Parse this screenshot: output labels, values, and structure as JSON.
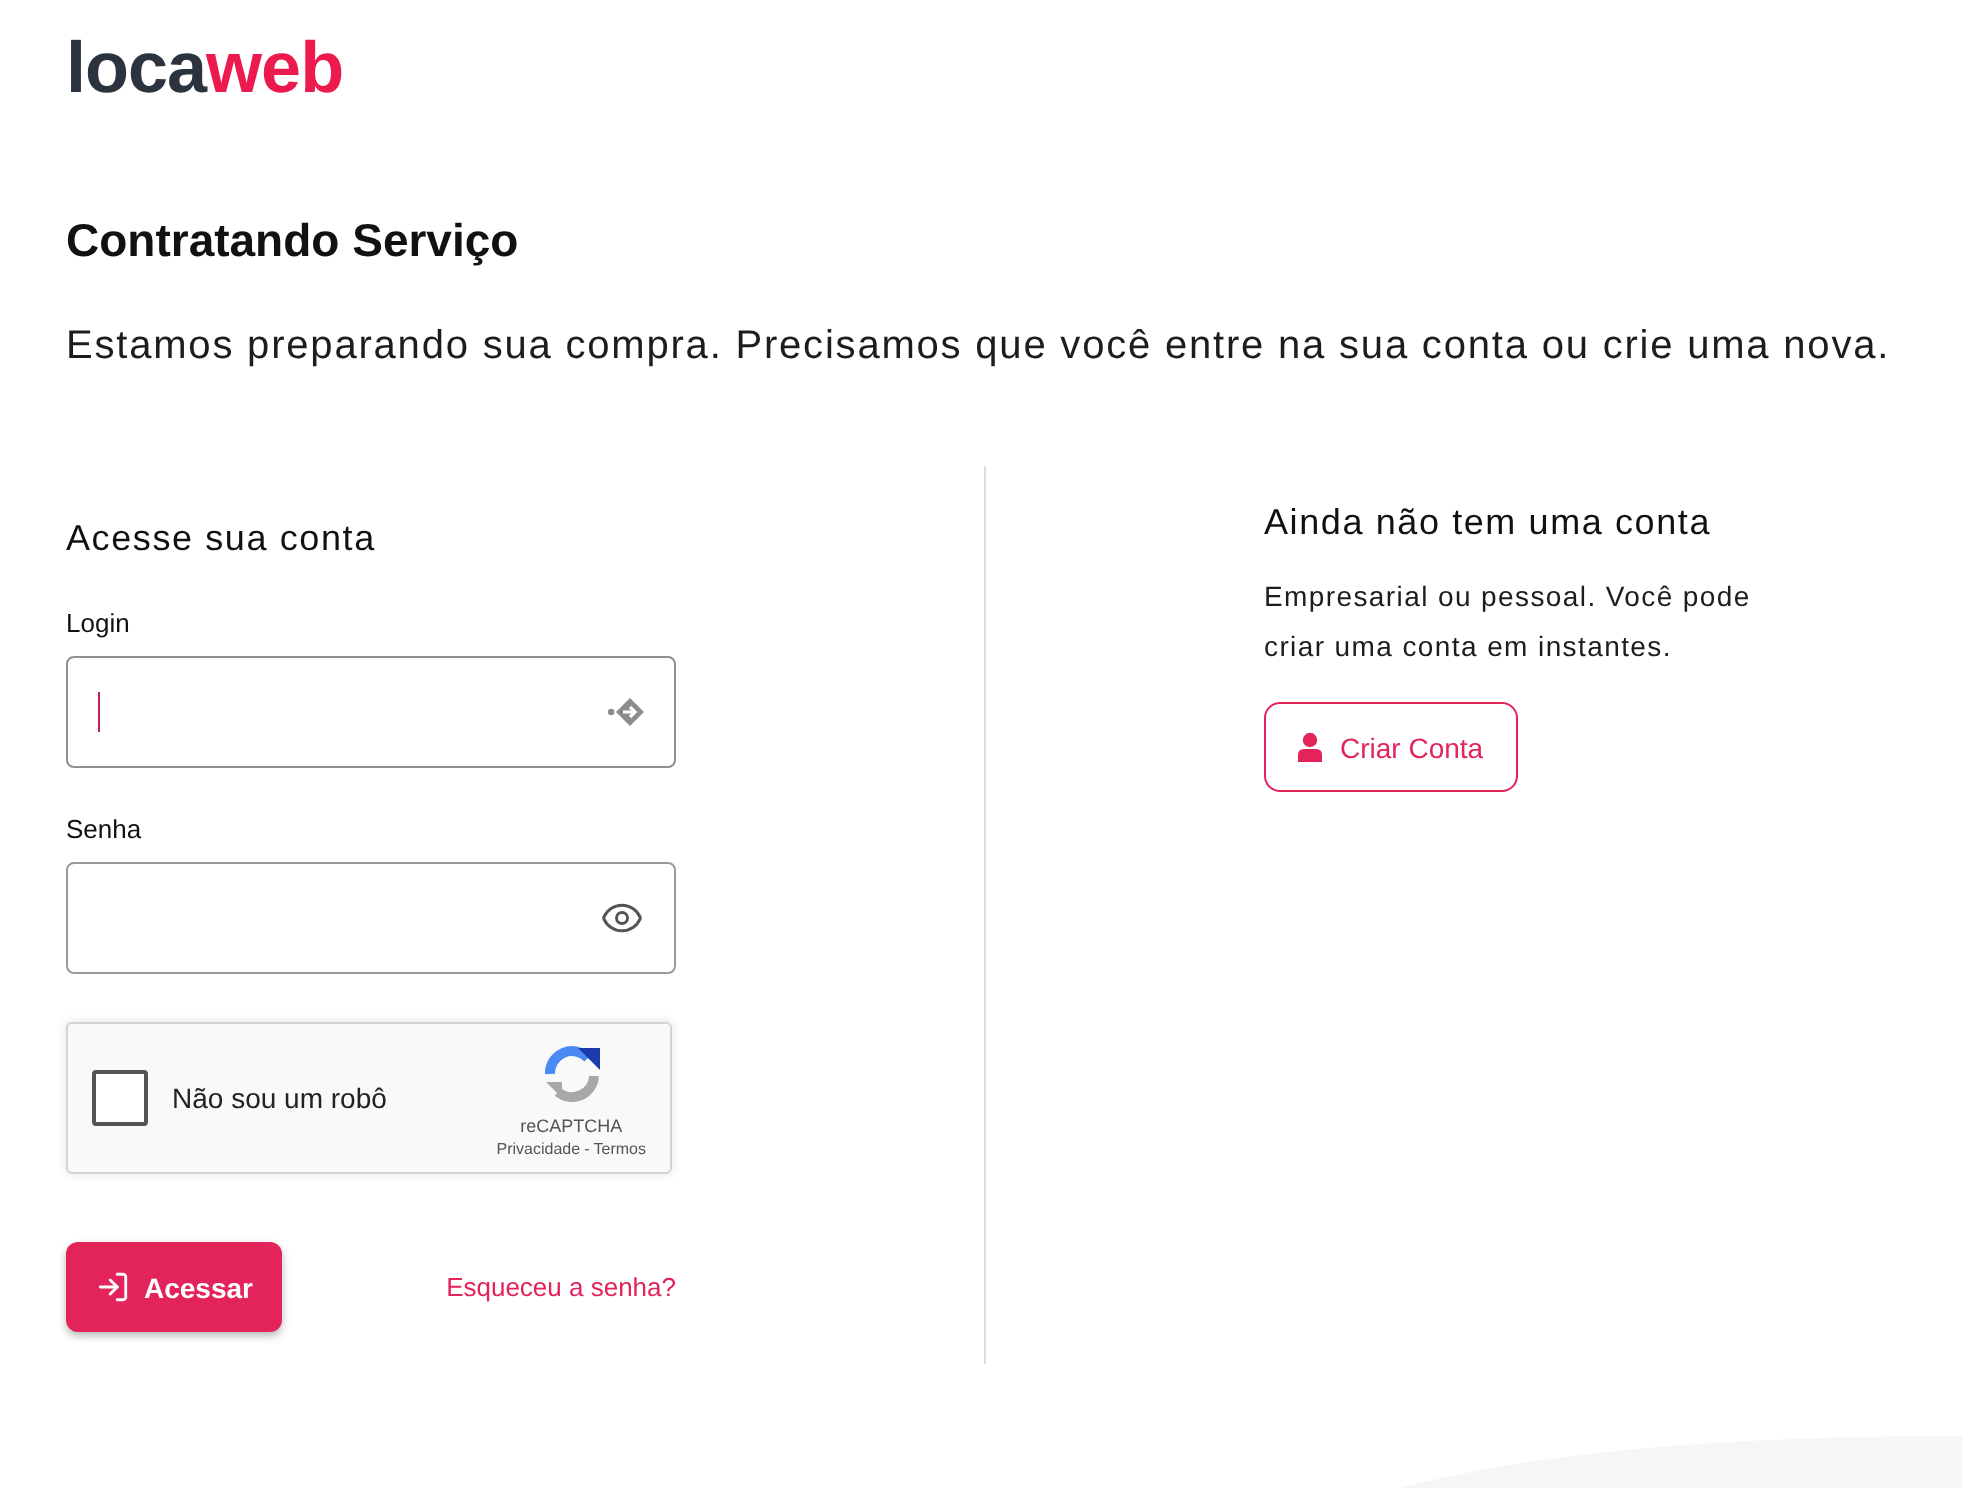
{
  "logo": {
    "text": "loca",
    "accent": "web"
  },
  "header": {
    "title": "Contratando Serviço",
    "subtitle": "Estamos preparando sua compra. Precisamos que você entre na sua conta ou crie uma nova."
  },
  "login_panel": {
    "title": "Acesse sua conta",
    "fields": [
      {
        "label": "Login",
        "kind": "text",
        "focused": true
      },
      {
        "label": "Senha",
        "kind": "password",
        "focused": false
      }
    ],
    "captcha": {
      "label": "Não sou um robô",
      "checked": false,
      "brand": "reCAPTCHA",
      "links": [
        "Privacidade",
        "Termos"
      ],
      "separator": "-"
    },
    "submit": "Acessar",
    "forgot_link": "Esqueceu a senha?"
  },
  "signup_panel": {
    "title": "Ainda não tem uma conta",
    "description": "Empresarial ou pessoal. Você pode criar uma conta em instantes.",
    "button": "Criar Conta"
  }
}
